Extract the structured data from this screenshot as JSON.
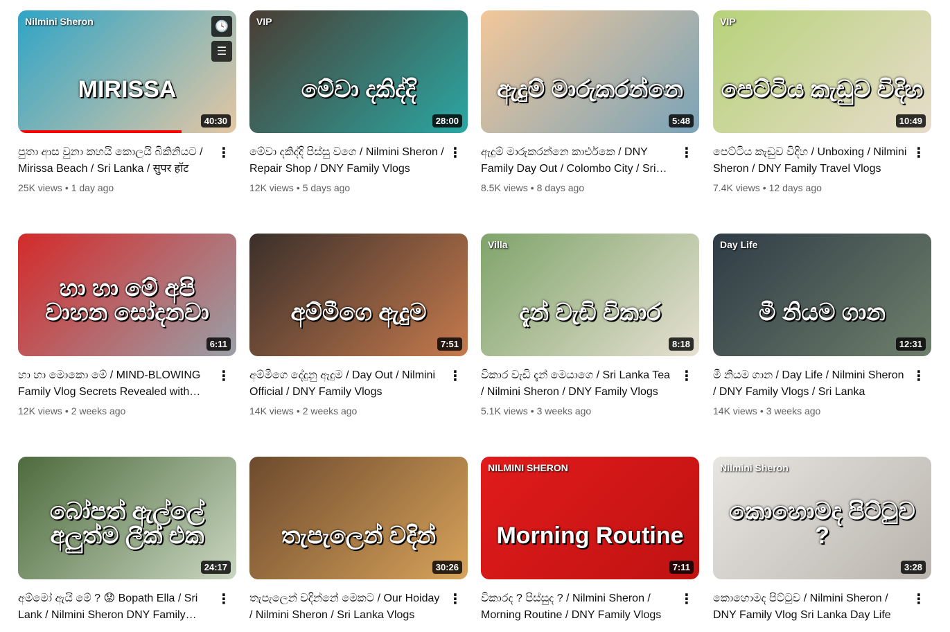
{
  "videos": [
    {
      "title": "පුතා ආස වුනා කහයි කොලයි බිකිනියට / Mirissa Beach / Sri Lanka / सुपर हॉट",
      "views": "25K views",
      "age": "1 day ago",
      "duration": "40:30",
      "thumb_text": "MIRISSA",
      "thumb_small": "Nilmini Sheron",
      "colors": [
        "#2fa4c6",
        "#e4c7a4"
      ],
      "progress": 0.75,
      "hover": true
    },
    {
      "title": "මේවා දකිද්දි පිස්සු වගෙ / Nilmini Sheron / Repair Shop / DNY Family Vlogs",
      "views": "12K views",
      "age": "5 days ago",
      "duration": "28:00",
      "thumb_text": "මේවා දකිද්දි",
      "thumb_small": "VIP",
      "colors": [
        "#4a3d33",
        "#2ba7a3"
      ]
    },
    {
      "title": "ඇදුම් මාරුකරන්නෙ කාර්එකෙ / DNY Family Day Out / Colombo City / Sri Lanka",
      "views": "8.5K views",
      "age": "8 days ago",
      "duration": "5:48",
      "thumb_text": "ඇදුම් මාරුකරන්නෙ",
      "thumb_small": "",
      "colors": [
        "#f3c79a",
        "#7aa3b8"
      ]
    },
    {
      "title": "පෙට්ටිය කැඩුව විදිහ / Unboxing / Nilmini Sheron / DNY Family Travel Vlogs",
      "views": "7.4K views",
      "age": "12 days ago",
      "duration": "10:49",
      "thumb_text": "පෙට්ටිය කැඩුව විදිහ",
      "thumb_small": "VIP",
      "colors": [
        "#b7d27a",
        "#e7dccb"
      ]
    },
    {
      "title": "හා හා මොකො මේ / MIND-BLOWING Family Vlog Secrets Revealed with Nilmini",
      "views": "12K views",
      "age": "2 weeks ago",
      "duration": "6:11",
      "thumb_text": "හා හා මේ අපි වාහන සෝදනවා",
      "thumb_small": "",
      "colors": [
        "#d42a2a",
        "#9aa0a8"
      ]
    },
    {
      "title": "අම්මීගෙ දේදුනු ඇදුම / Day Out / Nilmini Official / DNY Family Vlogs",
      "views": "14K views",
      "age": "2 weeks ago",
      "duration": "7:51",
      "thumb_text": "අම්මීගෙ ඇදුම",
      "thumb_small": "",
      "colors": [
        "#3a2f2a",
        "#c57a4d"
      ]
    },
    {
      "title": "විකාර වැඩි දැන් මෙයාගෙ / Sri Lanka Tea / Nilmini Sheron / DNY Family Vlogs",
      "views": "5.1K views",
      "age": "3 weeks ago",
      "duration": "8:18",
      "thumb_text": "දැන් වැඩි විකාර",
      "thumb_small": "Villa",
      "colors": [
        "#7fa46a",
        "#e6e0d2"
      ]
    },
    {
      "title": "මී නියම ගාන / Day Life / Nilmini Sheron / DNY Family Vlogs / Sri Lanka",
      "views": "14K views",
      "age": "3 weeks ago",
      "duration": "12:31",
      "thumb_text": "මී නියම ගාන",
      "thumb_small": "Day Life",
      "colors": [
        "#2f3b46",
        "#6e7f6b"
      ]
    },
    {
      "title": "අම්මෝ ඇයි මේ ? 😟 Bopath Ella / Sri Lank / Nilmini Sheron DNY Family Vlogs",
      "views": "",
      "age": "",
      "duration": "24:17",
      "thumb_text": "බෝපත් ඇල්ලේ අලුත්ම ලීක් එක",
      "thumb_small": "",
      "colors": [
        "#4d6b3d",
        "#c9d6c0"
      ]
    },
    {
      "title": "තැපැලෙන් වදින්නේ මෙකට / Our Hoiday / Nilmini Sheron / Sri Lanka Vlogs",
      "views": "",
      "age": "",
      "duration": "30:26",
      "thumb_text": "තැපැලෙන් වදින්",
      "thumb_small": "",
      "colors": [
        "#6d4a2e",
        "#d8a35a"
      ]
    },
    {
      "title": "විකාරද ? පිස්සුද ? / Nilmini Sheron / Morning Routine / DNY Family Vlogs",
      "views": "",
      "age": "",
      "duration": "7:11",
      "thumb_text": "Morning Routine",
      "thumb_small": "NILMINI SHERON",
      "colors": [
        "#e11b1b",
        "#c01212"
      ]
    },
    {
      "title": "කොහොමද පිට්ටුව / Nilmini Sheron / DNY Family Vlog Sri Lanka Day Life",
      "views": "",
      "age": "",
      "duration": "3:28",
      "thumb_text": "කොහොමද පිට්ටුව ?",
      "thumb_small": "Nilmini Sheron",
      "colors": [
        "#e8e6e2",
        "#b9b4ad"
      ]
    }
  ],
  "icons": {
    "menu": "more-vert-icon",
    "watch_later": "clock-icon",
    "queue": "add-to-queue-icon"
  }
}
